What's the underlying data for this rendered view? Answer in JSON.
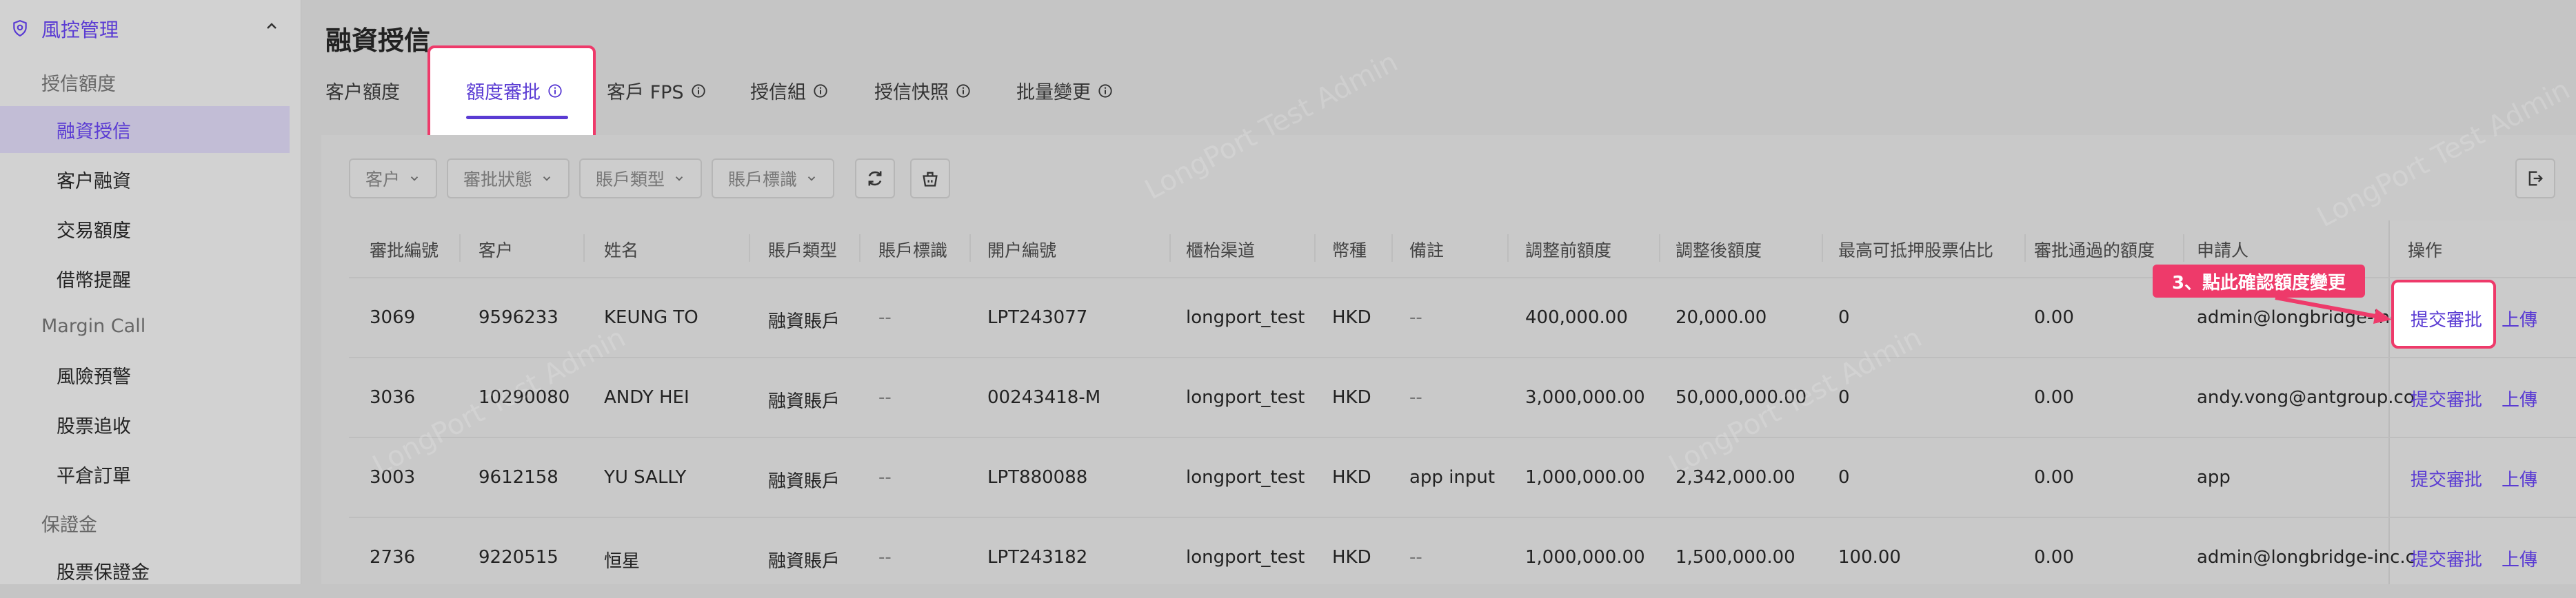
{
  "sidebar": {
    "header": "風控管理",
    "groups": [
      {
        "label": "授信額度",
        "items": [
          "融資授信",
          "客户融資",
          "交易額度",
          "借幣提醒"
        ]
      },
      {
        "label": "Margin Call",
        "items": [
          "風險預警",
          "股票追收",
          "平倉訂單"
        ]
      },
      {
        "label": "保證金",
        "items": [
          "股票保證金"
        ]
      }
    ],
    "active_item": "融資授信"
  },
  "page_title": "融資授信",
  "tabs": [
    {
      "label": "客户額度"
    },
    {
      "label": "額度審批"
    },
    {
      "label": "客戶 FPS"
    },
    {
      "label": "授信組"
    },
    {
      "label": "授信快照"
    },
    {
      "label": "批量變更"
    }
  ],
  "active_tab": "額度審批",
  "filters": [
    "客户",
    "審批狀態",
    "賬戶類型",
    "賬戶標識"
  ],
  "table": {
    "columns": [
      "審批編號",
      "客户",
      "姓名",
      "賬戶類型",
      "賬戶標識",
      "開户編號",
      "櫃枱渠道",
      "幣種",
      "備註",
      "調整前額度",
      "調整後額度",
      "最高可抵押股票佔比",
      "審批通過的額度",
      "申請人",
      "操作"
    ],
    "rows": [
      [
        "3069",
        "9596233",
        "KEUNG TO",
        "融資賬戶",
        "--",
        "LPT243077",
        "longport_test",
        "HKD",
        "--",
        "400,000.00",
        "20,000.00",
        "0",
        "0.00",
        "admin@longbridge-inc.c"
      ],
      [
        "3036",
        "10290080",
        "ANDY HEI",
        "融資賬戶",
        "--",
        "00243418-M",
        "longport_test",
        "HKD",
        "--",
        "3,000,000.00",
        "50,000,000.00",
        "0",
        "0.00",
        "andy.vong@antgroup.co"
      ],
      [
        "3003",
        "9612158",
        "YU SALLY",
        "融資賬戶",
        "--",
        "LPT880088",
        "longport_test",
        "HKD",
        "app input",
        "1,000,000.00",
        "2,342,000.00",
        "0",
        "0.00",
        "app"
      ],
      [
        "2736",
        "9220515",
        "恒星",
        "融資賬戶",
        "--",
        "LPT243182",
        "longport_test",
        "HKD",
        "--",
        "1,000,000.00",
        "1,500,000.00",
        "100.00",
        "0.00",
        "admin@longbridge-inc.c"
      ]
    ],
    "actions": {
      "approve": "提交審批",
      "upload": "上傳"
    }
  },
  "callout": "3、點此確認額度變更",
  "watermark": "LongPort Test Admin",
  "colors": {
    "accent": "#5a3bd3",
    "highlight": "#ee3a6a"
  }
}
